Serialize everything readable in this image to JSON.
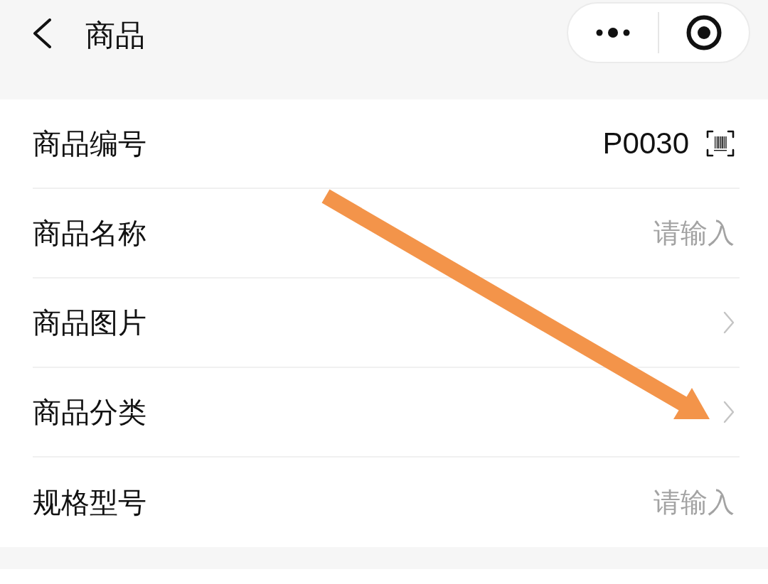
{
  "nav_bar": {
    "title": "商品"
  },
  "form_rows": [
    {
      "label": "商品编号",
      "kind": "code",
      "value": "P0030"
    },
    {
      "label": "商品名称",
      "kind": "input",
      "placeholder": "请输入"
    },
    {
      "label": "商品图片",
      "kind": "link"
    },
    {
      "label": "商品分类",
      "kind": "link"
    },
    {
      "label": "规格型号",
      "kind": "input",
      "placeholder": "请输入"
    }
  ],
  "annotation": {
    "kind": "arrow"
  }
}
